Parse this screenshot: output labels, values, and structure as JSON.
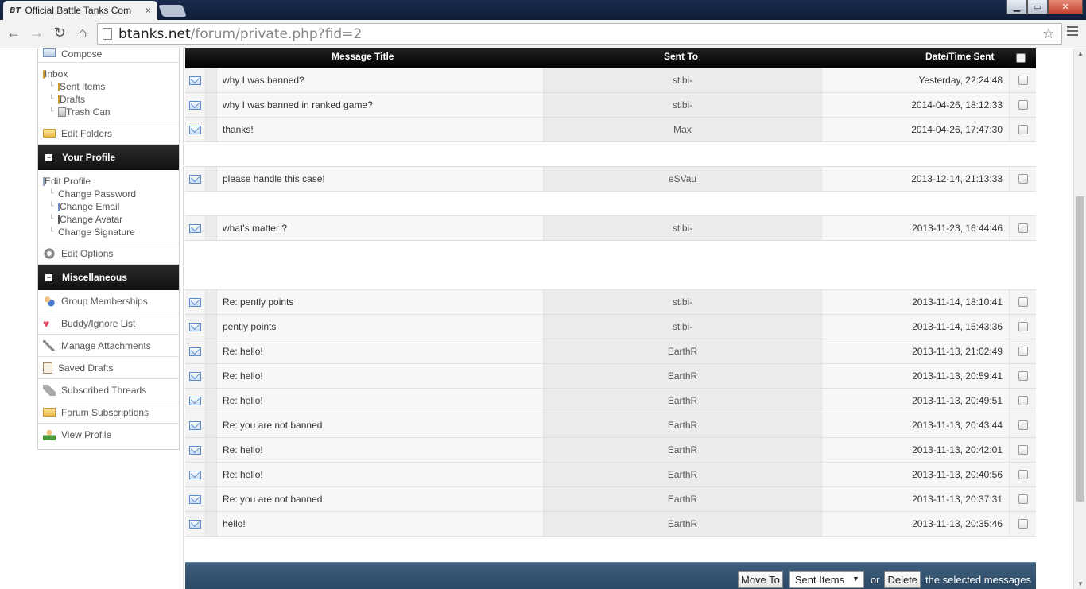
{
  "browser": {
    "tab_title": "Official Battle Tanks Com",
    "tab_favicon": "BT",
    "tab_close": "×",
    "url_domain": "btanks.net",
    "url_path": "/forum/private.php?fid=2"
  },
  "sidebar": {
    "compose": "Compose",
    "folders": {
      "inbox": "Inbox",
      "sub": [
        "Sent Items",
        "Drafts",
        "Trash Can"
      ]
    },
    "edit_folders": "Edit Folders",
    "profile_head": "Your Profile",
    "profile": {
      "edit_profile": "Edit Profile",
      "sub": [
        "Change Password",
        "Change Email",
        "Change Avatar",
        "Change Signature"
      ]
    },
    "edit_options": "Edit Options",
    "misc_head": "Miscellaneous",
    "misc": [
      "Group Memberships",
      "Buddy/Ignore List",
      "Manage Attachments",
      "Saved Drafts",
      "Subscribed Threads",
      "Forum Subscriptions",
      "View Profile"
    ]
  },
  "table": {
    "headers": {
      "title": "Message Title",
      "sent_to": "Sent To",
      "date": "Date/Time Sent"
    },
    "rows": [
      {
        "title": "why I was banned?",
        "to": "stibi-",
        "date": "Yesterday, 22:24:48"
      },
      {
        "title": "why I was banned in ranked game?",
        "to": "stibi-",
        "date": "2014-04-26, 18:12:33"
      },
      {
        "title": "thanks!",
        "to": "Max",
        "date": "2014-04-26, 17:47:30"
      },
      {
        "title": "please handle this case!",
        "to": "eSVau",
        "date": "2013-12-14, 21:13:33"
      },
      {
        "title": "what's matter ?",
        "to": "stibi-",
        "date": "2013-11-23, 16:44:46"
      },
      {
        "title": "Re: pently points",
        "to": "stibi-",
        "date": "2013-11-14, 18:10:41"
      },
      {
        "title": "pently points",
        "to": "stibi-",
        "date": "2013-11-14, 15:43:36"
      },
      {
        "title": "Re: hello!",
        "to": "EarthR",
        "date": "2013-11-13, 21:02:49"
      },
      {
        "title": "Re: hello!",
        "to": "EarthR",
        "date": "2013-11-13, 20:59:41"
      },
      {
        "title": "Re: hello!",
        "to": "EarthR",
        "date": "2013-11-13, 20:49:51"
      },
      {
        "title": "Re: you are not banned",
        "to": "EarthR",
        "date": "2013-11-13, 20:43:44"
      },
      {
        "title": "Re: hello!",
        "to": "EarthR",
        "date": "2013-11-13, 20:42:01"
      },
      {
        "title": "Re: hello!",
        "to": "EarthR",
        "date": "2013-11-13, 20:40:56"
      },
      {
        "title": "Re: you are not banned",
        "to": "EarthR",
        "date": "2013-11-13, 20:37:31"
      },
      {
        "title": "hello!",
        "to": "EarthR",
        "date": "2013-11-13, 20:35:46"
      }
    ]
  },
  "footer": {
    "move_to": "Move To",
    "folder_selected": "Sent Items",
    "or": "or",
    "delete": "Delete",
    "suffix": "the selected messages"
  },
  "colors": {
    "header_bg": "#000000",
    "footer_bg": "#34546f"
  },
  "icons": {
    "message": "envelope-icon",
    "checkbox": "checkbox"
  }
}
